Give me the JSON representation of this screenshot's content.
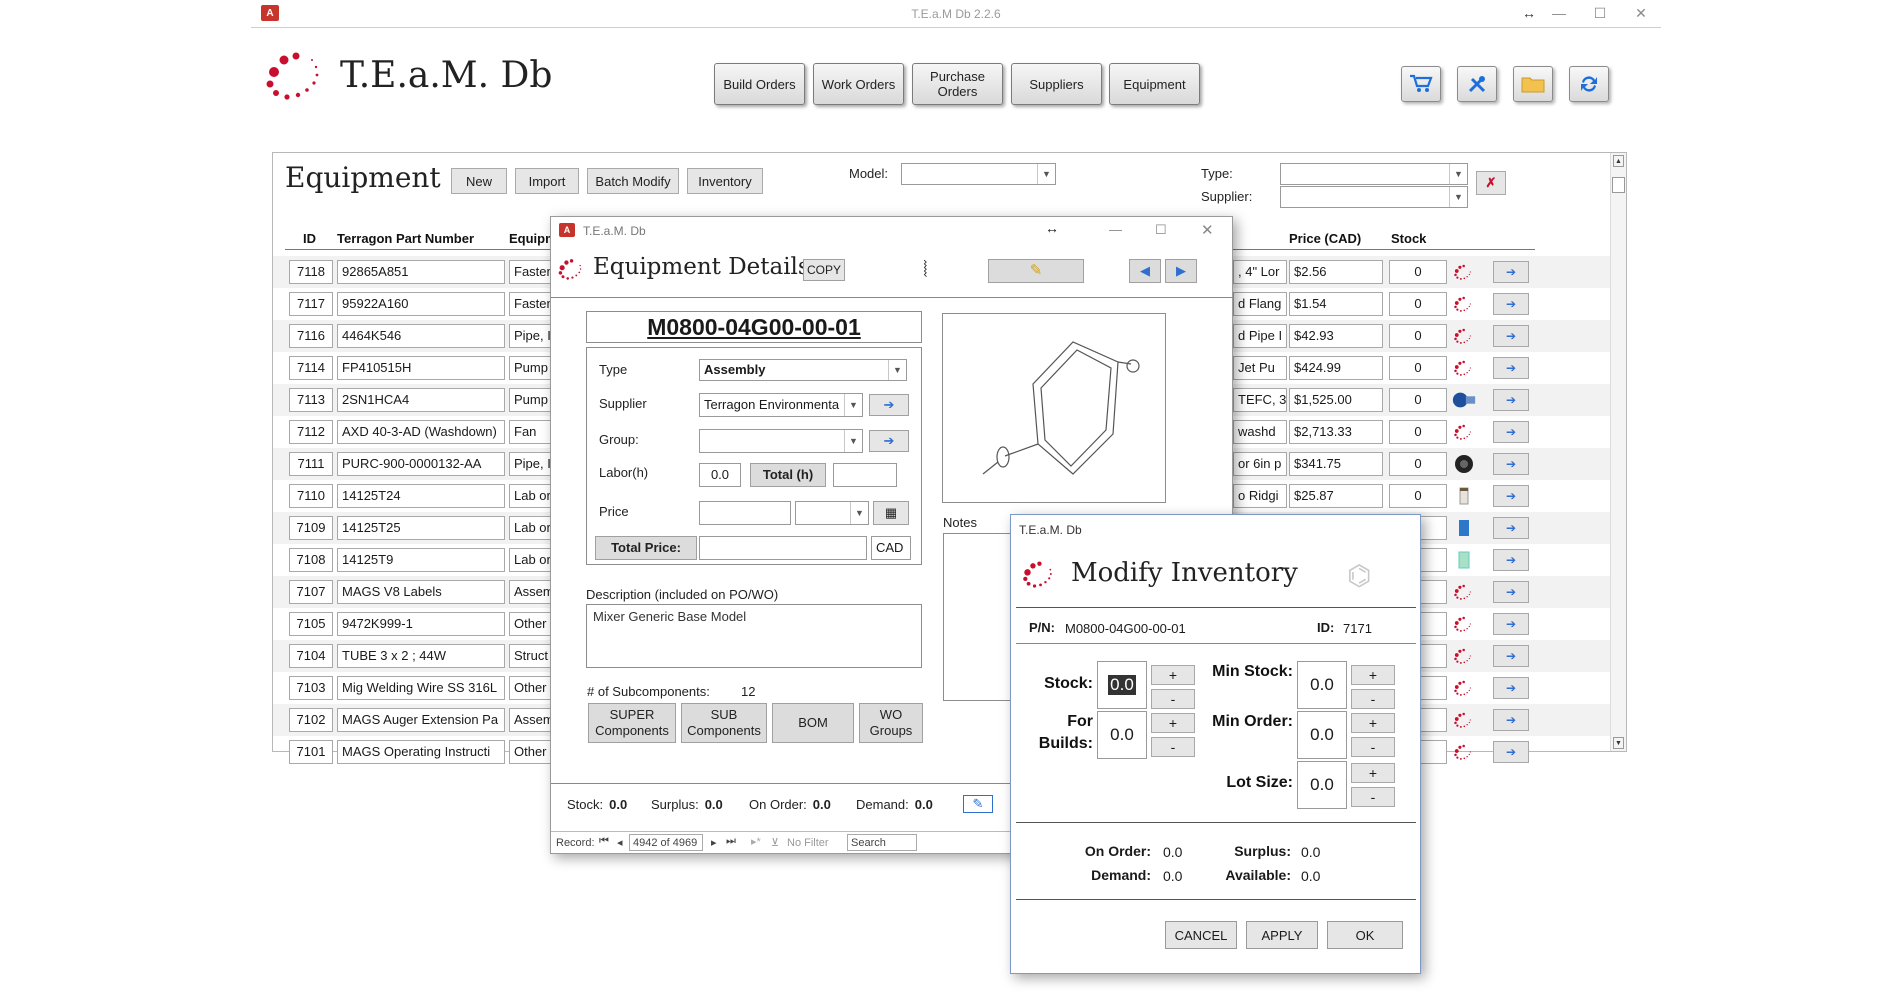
{
  "app": {
    "window_title": "T.E.a.M Db 2.2.6",
    "name": "T.E.a.M. Db"
  },
  "nav": {
    "build_orders": "Build Orders",
    "work_orders": "Work Orders",
    "purchase_orders": "Purchase Orders",
    "suppliers": "Suppliers",
    "equipment": "Equipment"
  },
  "equipment": {
    "title": "Equipment",
    "buttons": {
      "new": "New",
      "import": "Import",
      "batch_modify": "Batch Modify",
      "inventory": "Inventory"
    },
    "filters": {
      "model_label": "Model:",
      "type_label": "Type:",
      "supplier_label": "Supplier:"
    },
    "columns": {
      "id": "ID",
      "part_number": "Terragon Part Number",
      "equipment": "Equipm",
      "price": "Price (CAD)",
      "stock": "Stock"
    },
    "rows": [
      {
        "id": "7118",
        "pn": "92865A851",
        "cat": "Fasten",
        "desc": ", 4\" Lor",
        "price": "$2.56",
        "stock": "0",
        "icon": "logo-icon"
      },
      {
        "id": "7117",
        "pn": "95922A160",
        "cat": "Fasten",
        "desc": "d Flang",
        "price": "$1.54",
        "stock": "0",
        "icon": "logo-icon"
      },
      {
        "id": "7116",
        "pn": "4464K546",
        "cat": "Pipe, I",
        "desc": "d Pipe I",
        "price": "$42.93",
        "stock": "0",
        "icon": "logo-icon"
      },
      {
        "id": "7114",
        "pn": "FP410515H",
        "cat": "Pump",
        "desc": "Jet Pu",
        "price": "$424.99",
        "stock": "0",
        "icon": "logo-icon"
      },
      {
        "id": "7113",
        "pn": "2SN1HCA4",
        "cat": "Pump",
        "desc": "TEFC, 3",
        "price": "$1,525.00",
        "stock": "0",
        "icon": "pump-icon"
      },
      {
        "id": "7112",
        "pn": "AXD 40-3-AD (Washdown)",
        "cat": "Fan",
        "desc": "washd",
        "price": "$2,713.33",
        "stock": "0",
        "icon": "logo-icon"
      },
      {
        "id": "7111",
        "pn": "PURC-900-0000132-AA",
        "cat": "Pipe, I",
        "desc": "or 6in p",
        "price": "$341.75",
        "stock": "0",
        "icon": "fitting-icon"
      },
      {
        "id": "7110",
        "pn": "14125T24",
        "cat": "Lab or",
        "desc": "o Ridgi",
        "price": "$25.87",
        "stock": "0",
        "icon": "container-icon"
      },
      {
        "id": "7109",
        "pn": "14125T25",
        "cat": "Lab or",
        "desc": "",
        "price": "",
        "stock": "",
        "icon": "blue-container-icon"
      },
      {
        "id": "7108",
        "pn": "14125T9",
        "cat": "Lab or",
        "desc": "",
        "price": "",
        "stock": "",
        "icon": "green-container-icon"
      },
      {
        "id": "7107",
        "pn": "MAGS V8 Labels",
        "cat": "Assem",
        "desc": "",
        "price": "",
        "stock": "",
        "icon": "logo-icon"
      },
      {
        "id": "7105",
        "pn": "9472K999-1",
        "cat": "Other",
        "desc": "",
        "price": "",
        "stock": "",
        "icon": "logo-icon"
      },
      {
        "id": "7104",
        "pn": "TUBE 3 x 2 ; 44W",
        "cat": "Struct",
        "desc": "",
        "price": "",
        "stock": "",
        "icon": "logo-icon"
      },
      {
        "id": "7103",
        "pn": "Mig Welding Wire SS 316L",
        "cat": "Other",
        "desc": "",
        "price": "",
        "stock": "",
        "icon": "logo-icon"
      },
      {
        "id": "7102",
        "pn": "MAGS Auger Extension Pa",
        "cat": "Assem",
        "desc": "",
        "price": "",
        "stock": "",
        "icon": "logo-icon"
      },
      {
        "id": "7101",
        "pn": "MAGS Operating Instructi",
        "cat": "Other",
        "desc": "",
        "price": "",
        "stock": "",
        "icon": "logo-icon"
      }
    ]
  },
  "details": {
    "window_title": "T.E.a.M. Db",
    "title": "Equipment Details",
    "copy": "COPY",
    "part_number": "M0800-04G00-00-01",
    "type_label": "Type",
    "type_value": "Assembly",
    "supplier_label": "Supplier",
    "supplier_value": "Terragon Environmenta",
    "group_label": "Group:",
    "labor_label": "Labor(h)",
    "labor_value": "0.0",
    "total_h": "Total (h)",
    "price_label": "Price",
    "total_price": "Total Price:",
    "currency": "CAD",
    "desc_label": "Description (included on PO/WO)",
    "desc_value": "Mixer Generic Base Model",
    "notes_label": "Notes",
    "subcomp_label": "# of Subcomponents:",
    "subcomp_count": "12",
    "super_components": "SUPER Components",
    "sub_components": "SUB Components",
    "bom": "BOM",
    "wo_groups": "WO Groups",
    "status": {
      "stock_label": "Stock:",
      "stock": "0.0",
      "surplus_label": "Surplus:",
      "surplus": "0.0",
      "on_order_label": "On Order:",
      "on_order": "0.0",
      "demand_label": "Demand:",
      "demand": "0.0"
    },
    "record_nav": {
      "label": "Record:",
      "position": "4942 of 4969",
      "no_filter": "No Filter",
      "search": "Search"
    }
  },
  "modify": {
    "window_title": "T.E.a.M. Db",
    "title": "Modify Inventory",
    "pn_label": "P/N:",
    "pn": "M0800-04G00-00-01",
    "id_label": "ID:",
    "id": "7171",
    "stock_label": "Stock:",
    "stock": "0.0",
    "for_builds_label": "For Builds:",
    "for_builds": "0.0",
    "min_stock_label": "Min Stock:",
    "min_stock": "0.0",
    "min_order_label": "Min Order:",
    "min_order": "0.0",
    "lot_size_label": "Lot Size:",
    "lot_size": "0.0",
    "plus": "+",
    "minus": "-",
    "on_order_label": "On Order:",
    "on_order": "0.0",
    "demand_label": "Demand:",
    "demand": "0.0",
    "surplus_label": "Surplus:",
    "surplus": "0.0",
    "available_label": "Available:",
    "available": "0.0",
    "cancel": "CANCEL",
    "apply": "APPLY",
    "ok": "OK"
  },
  "colors": {
    "accent_red": "#c8102e",
    "arrow_blue": "#2e6fd0",
    "access_red": "#c7342c"
  }
}
